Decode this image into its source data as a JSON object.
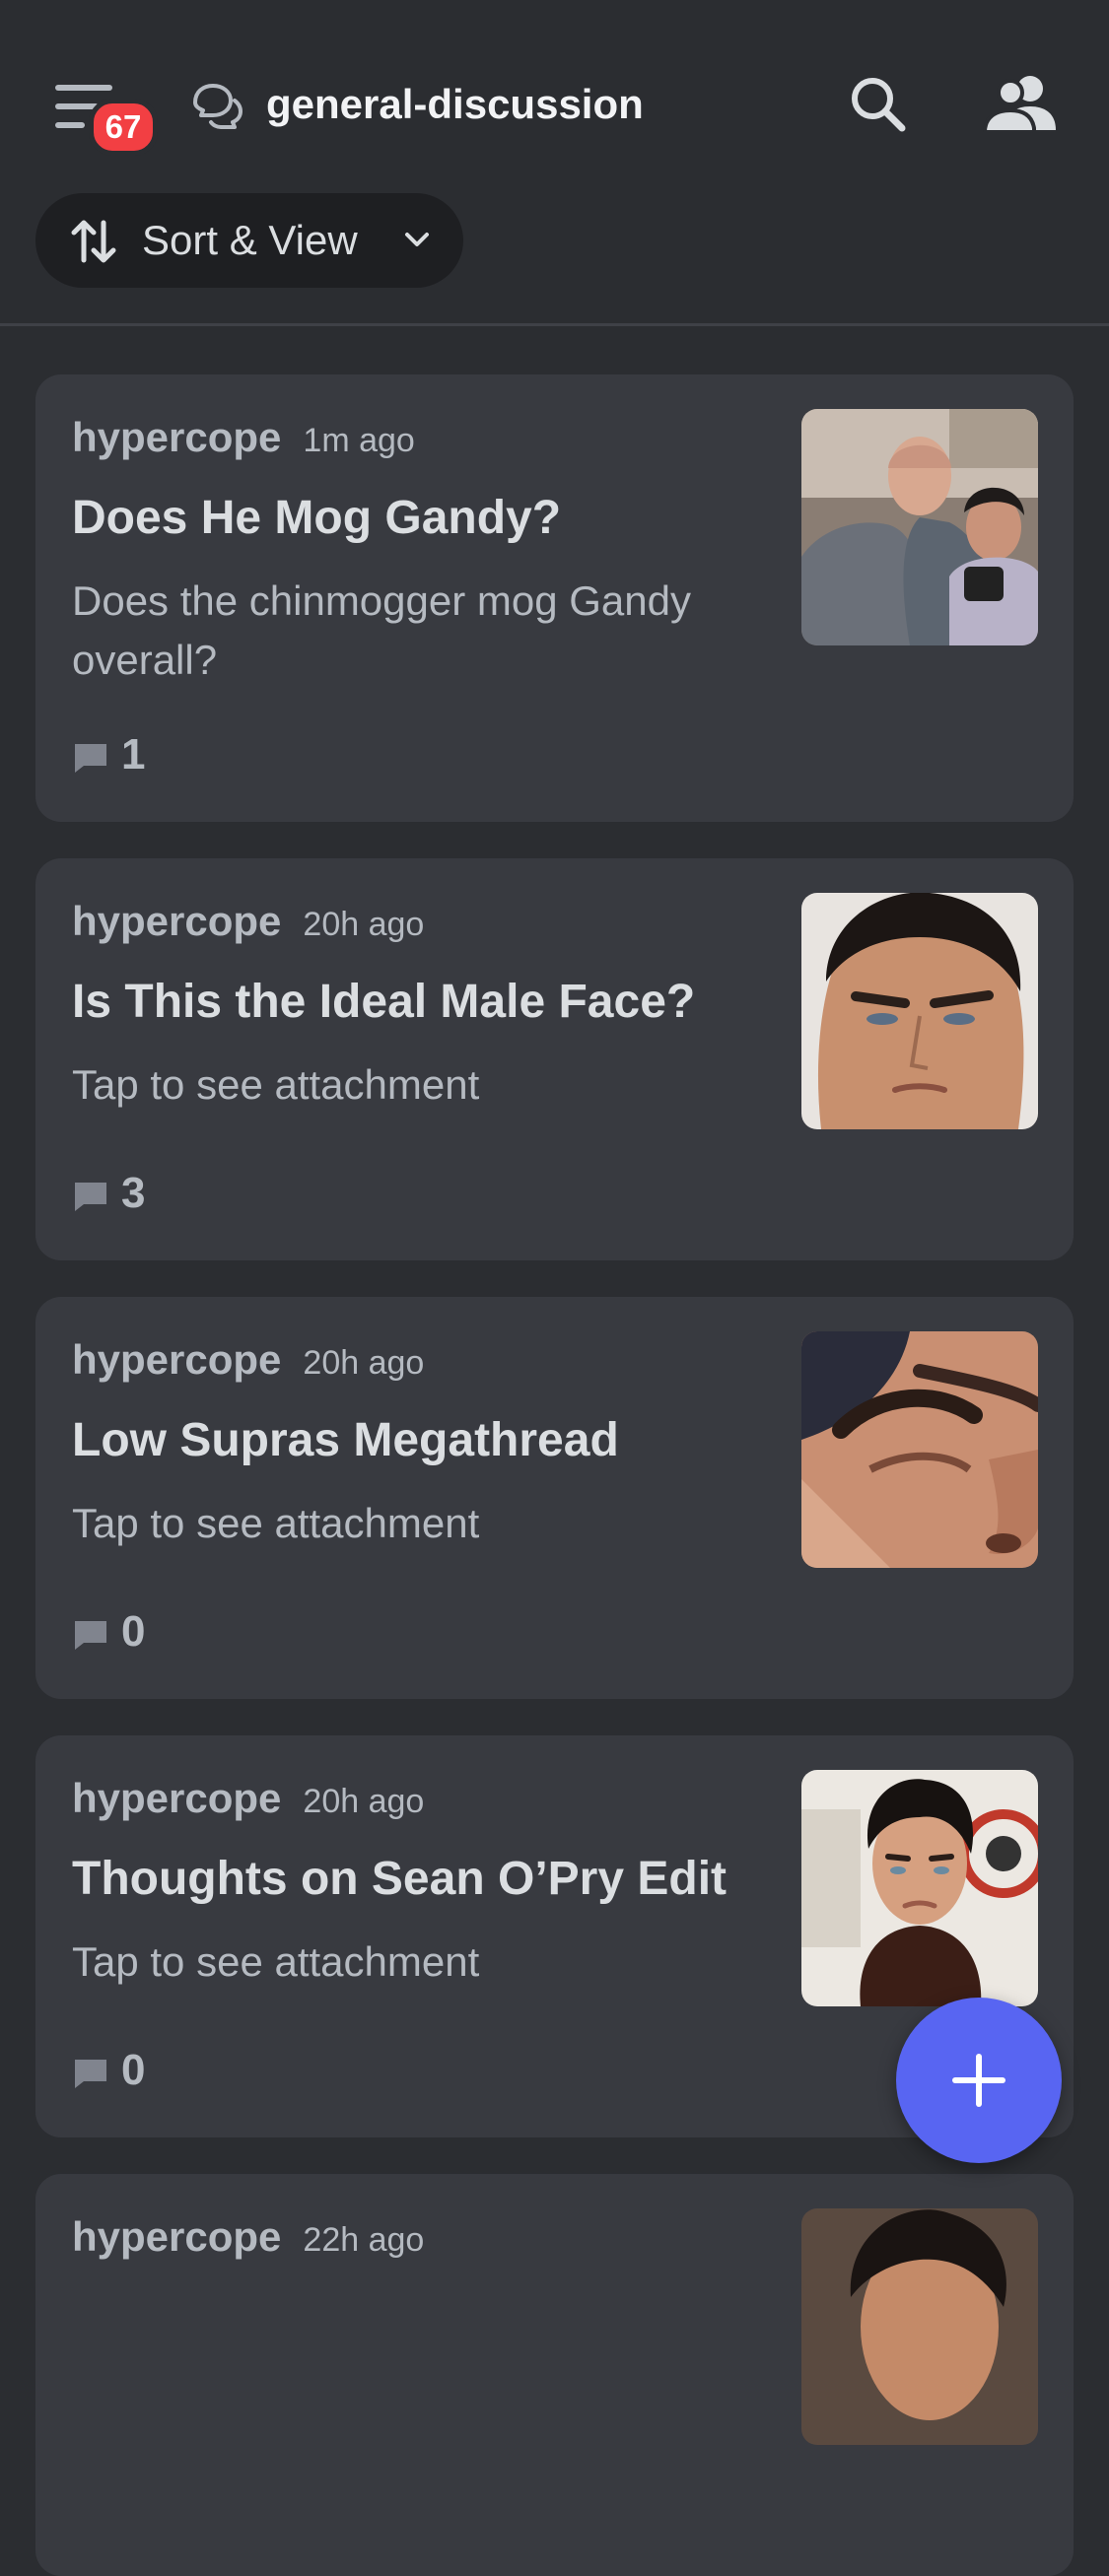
{
  "header": {
    "notification_count": "67",
    "channel_name": "general-discussion",
    "sort_label": "Sort & View"
  },
  "posts": [
    {
      "author": "hypercope",
      "time": "1m ago",
      "title": "Does He Mog Gandy?",
      "snippet": "Does the chinmogger mog Gandy overall?",
      "replies": "1",
      "thumbnail": "two-men-photo"
    },
    {
      "author": "hypercope",
      "time": "20h ago",
      "title": "Is This the Ideal Male Face?",
      "snippet": "Tap to see attachment",
      "replies": "3",
      "thumbnail": "male-face-closeup"
    },
    {
      "author": "hypercope",
      "time": "20h ago",
      "title": "Low Supras Megathread",
      "snippet": "Tap to see attachment",
      "replies": "0",
      "thumbnail": "eye-brow-closeup"
    },
    {
      "author": "hypercope",
      "time": "20h ago",
      "title": "Thoughts on Sean O’Pry Edit",
      "snippet": "Tap to see attachment",
      "replies": "0",
      "thumbnail": "man-portrait-event"
    },
    {
      "author": "hypercope",
      "time": "22h ago",
      "title": "",
      "snippet": "",
      "replies": "",
      "thumbnail": "man-portrait"
    }
  ],
  "colors": {
    "background": "#2b2d31",
    "card": "#383a40",
    "accent": "#5865f2",
    "badge": "#f23f43"
  }
}
